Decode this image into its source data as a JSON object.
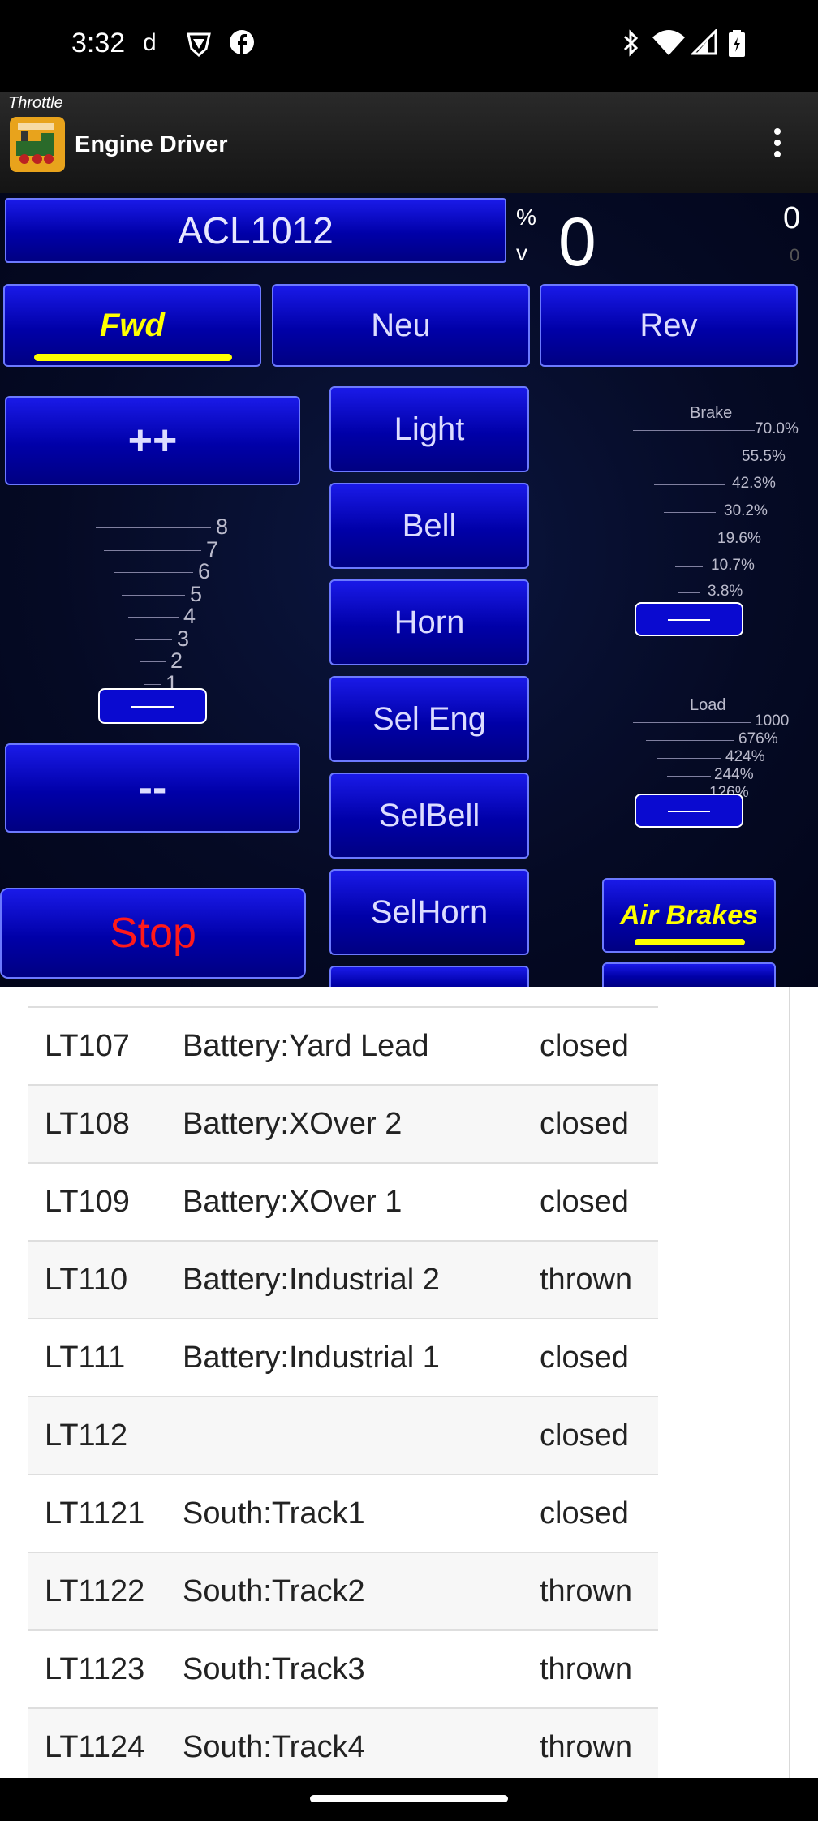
{
  "status": {
    "time": "3:32"
  },
  "appbar": {
    "subtitle": "Throttle",
    "title": "Engine Driver"
  },
  "throttle": {
    "loco": "ACL1012",
    "speed_unit_pct": "%",
    "speed_unit_v": "v",
    "speed": "0",
    "readout_top": "0",
    "readout_bottom": "0",
    "direction": {
      "fwd": "Fwd",
      "neu": "Neu",
      "rev": "Rev",
      "selected": "Fwd"
    },
    "plus_label": "++",
    "minus_label": "--",
    "stop_label": "Stop",
    "notch_scale": [
      "8",
      "7",
      "6",
      "5",
      "4",
      "3",
      "2",
      "1"
    ],
    "functions": [
      "Light",
      "Bell",
      "Horn",
      "Sel Eng",
      "SelBell",
      "SelHorn"
    ],
    "brake": {
      "label": "Brake",
      "ticks": [
        "70.0%",
        "55.5%",
        "42.3%",
        "30.2%",
        "19.6%",
        "10.7%",
        "3.8%"
      ],
      "level": 0
    },
    "load": {
      "label": "Load",
      "ticks": [
        "1000",
        "676%",
        "424%",
        "244%",
        "126%"
      ],
      "level": 0
    },
    "air_brakes_label": "Air Brakes",
    "colors": {
      "accent": "#ffff00",
      "button": "#0000c0",
      "stop": "#ff1a1a"
    }
  },
  "turnouts": [
    {
      "id": "LT107",
      "name": "Battery:Yard Lead",
      "state": "closed"
    },
    {
      "id": "LT108",
      "name": "Battery:XOver 2",
      "state": "closed"
    },
    {
      "id": "LT109",
      "name": "Battery:XOver 1",
      "state": "closed"
    },
    {
      "id": "LT110",
      "name": "Battery:Industrial 2",
      "state": "thrown"
    },
    {
      "id": "LT111",
      "name": "Battery:Industrial 1",
      "state": "closed"
    },
    {
      "id": "LT112",
      "name": "",
      "state": "closed"
    },
    {
      "id": "LT1121",
      "name": "South:Track1",
      "state": "closed"
    },
    {
      "id": "LT1122",
      "name": "South:Track2",
      "state": "thrown"
    },
    {
      "id": "LT1123",
      "name": "South:Track3",
      "state": "thrown"
    },
    {
      "id": "LT1124",
      "name": "South:Track4",
      "state": "thrown"
    }
  ]
}
